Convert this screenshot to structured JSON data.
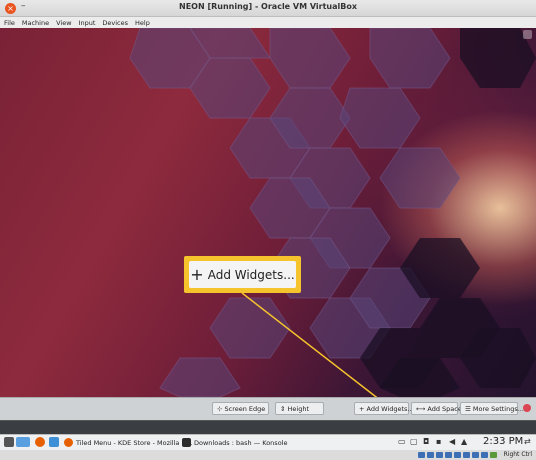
{
  "window": {
    "title": "NEON [Running] - Oracle VM VirtualBox",
    "close_glyph": "×",
    "minimize_glyph": "–"
  },
  "menubar": {
    "items": [
      "File",
      "Machine",
      "View",
      "Input",
      "Devices",
      "Help"
    ]
  },
  "callout": {
    "plus": "+",
    "label": "Add Widgets..."
  },
  "panel_toolbar": {
    "screen_edge": "⊹ Screen Edge",
    "height": "⇕ Height",
    "add_widgets": "+ Add Widgets...",
    "add_spacer": "⟷ Add Spacer",
    "more_settings": "☰ More Settings..."
  },
  "taskbar": {
    "tasks": [
      {
        "label": "Tiled Menu - KDE Store - Mozilla Fi...",
        "icon": "firefox-icon",
        "color": "#e66000"
      },
      {
        "label": "Downloads : bash — Konsole",
        "icon": "konsole-icon",
        "color": "#2b2b2b"
      }
    ],
    "clock": "2:33 PM"
  },
  "statusbar": {
    "host_key": "Right Ctrl"
  },
  "colors": {
    "accent_yellow": "#f5c32c",
    "close_red": "#e95420"
  }
}
